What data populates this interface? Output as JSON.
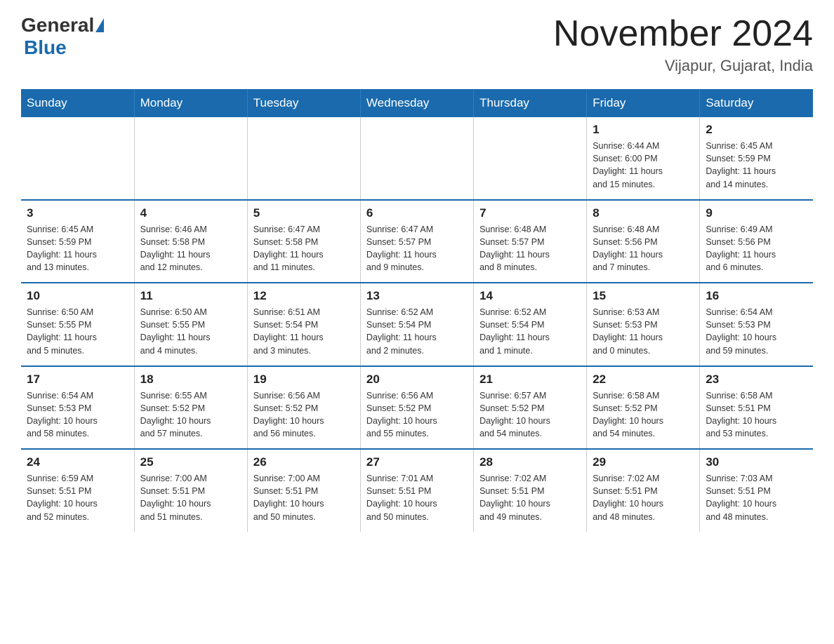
{
  "header": {
    "logo_general": "General",
    "logo_blue": "Blue",
    "month_title": "November 2024",
    "location": "Vijapur, Gujarat, India"
  },
  "weekdays": [
    "Sunday",
    "Monday",
    "Tuesday",
    "Wednesday",
    "Thursday",
    "Friday",
    "Saturday"
  ],
  "weeks": [
    [
      {
        "day": "",
        "info": ""
      },
      {
        "day": "",
        "info": ""
      },
      {
        "day": "",
        "info": ""
      },
      {
        "day": "",
        "info": ""
      },
      {
        "day": "",
        "info": ""
      },
      {
        "day": "1",
        "info": "Sunrise: 6:44 AM\nSunset: 6:00 PM\nDaylight: 11 hours\nand 15 minutes."
      },
      {
        "day": "2",
        "info": "Sunrise: 6:45 AM\nSunset: 5:59 PM\nDaylight: 11 hours\nand 14 minutes."
      }
    ],
    [
      {
        "day": "3",
        "info": "Sunrise: 6:45 AM\nSunset: 5:59 PM\nDaylight: 11 hours\nand 13 minutes."
      },
      {
        "day": "4",
        "info": "Sunrise: 6:46 AM\nSunset: 5:58 PM\nDaylight: 11 hours\nand 12 minutes."
      },
      {
        "day": "5",
        "info": "Sunrise: 6:47 AM\nSunset: 5:58 PM\nDaylight: 11 hours\nand 11 minutes."
      },
      {
        "day": "6",
        "info": "Sunrise: 6:47 AM\nSunset: 5:57 PM\nDaylight: 11 hours\nand 9 minutes."
      },
      {
        "day": "7",
        "info": "Sunrise: 6:48 AM\nSunset: 5:57 PM\nDaylight: 11 hours\nand 8 minutes."
      },
      {
        "day": "8",
        "info": "Sunrise: 6:48 AM\nSunset: 5:56 PM\nDaylight: 11 hours\nand 7 minutes."
      },
      {
        "day": "9",
        "info": "Sunrise: 6:49 AM\nSunset: 5:56 PM\nDaylight: 11 hours\nand 6 minutes."
      }
    ],
    [
      {
        "day": "10",
        "info": "Sunrise: 6:50 AM\nSunset: 5:55 PM\nDaylight: 11 hours\nand 5 minutes."
      },
      {
        "day": "11",
        "info": "Sunrise: 6:50 AM\nSunset: 5:55 PM\nDaylight: 11 hours\nand 4 minutes."
      },
      {
        "day": "12",
        "info": "Sunrise: 6:51 AM\nSunset: 5:54 PM\nDaylight: 11 hours\nand 3 minutes."
      },
      {
        "day": "13",
        "info": "Sunrise: 6:52 AM\nSunset: 5:54 PM\nDaylight: 11 hours\nand 2 minutes."
      },
      {
        "day": "14",
        "info": "Sunrise: 6:52 AM\nSunset: 5:54 PM\nDaylight: 11 hours\nand 1 minute."
      },
      {
        "day": "15",
        "info": "Sunrise: 6:53 AM\nSunset: 5:53 PM\nDaylight: 11 hours\nand 0 minutes."
      },
      {
        "day": "16",
        "info": "Sunrise: 6:54 AM\nSunset: 5:53 PM\nDaylight: 10 hours\nand 59 minutes."
      }
    ],
    [
      {
        "day": "17",
        "info": "Sunrise: 6:54 AM\nSunset: 5:53 PM\nDaylight: 10 hours\nand 58 minutes."
      },
      {
        "day": "18",
        "info": "Sunrise: 6:55 AM\nSunset: 5:52 PM\nDaylight: 10 hours\nand 57 minutes."
      },
      {
        "day": "19",
        "info": "Sunrise: 6:56 AM\nSunset: 5:52 PM\nDaylight: 10 hours\nand 56 minutes."
      },
      {
        "day": "20",
        "info": "Sunrise: 6:56 AM\nSunset: 5:52 PM\nDaylight: 10 hours\nand 55 minutes."
      },
      {
        "day": "21",
        "info": "Sunrise: 6:57 AM\nSunset: 5:52 PM\nDaylight: 10 hours\nand 54 minutes."
      },
      {
        "day": "22",
        "info": "Sunrise: 6:58 AM\nSunset: 5:52 PM\nDaylight: 10 hours\nand 54 minutes."
      },
      {
        "day": "23",
        "info": "Sunrise: 6:58 AM\nSunset: 5:51 PM\nDaylight: 10 hours\nand 53 minutes."
      }
    ],
    [
      {
        "day": "24",
        "info": "Sunrise: 6:59 AM\nSunset: 5:51 PM\nDaylight: 10 hours\nand 52 minutes."
      },
      {
        "day": "25",
        "info": "Sunrise: 7:00 AM\nSunset: 5:51 PM\nDaylight: 10 hours\nand 51 minutes."
      },
      {
        "day": "26",
        "info": "Sunrise: 7:00 AM\nSunset: 5:51 PM\nDaylight: 10 hours\nand 50 minutes."
      },
      {
        "day": "27",
        "info": "Sunrise: 7:01 AM\nSunset: 5:51 PM\nDaylight: 10 hours\nand 50 minutes."
      },
      {
        "day": "28",
        "info": "Sunrise: 7:02 AM\nSunset: 5:51 PM\nDaylight: 10 hours\nand 49 minutes."
      },
      {
        "day": "29",
        "info": "Sunrise: 7:02 AM\nSunset: 5:51 PM\nDaylight: 10 hours\nand 48 minutes."
      },
      {
        "day": "30",
        "info": "Sunrise: 7:03 AM\nSunset: 5:51 PM\nDaylight: 10 hours\nand 48 minutes."
      }
    ]
  ]
}
